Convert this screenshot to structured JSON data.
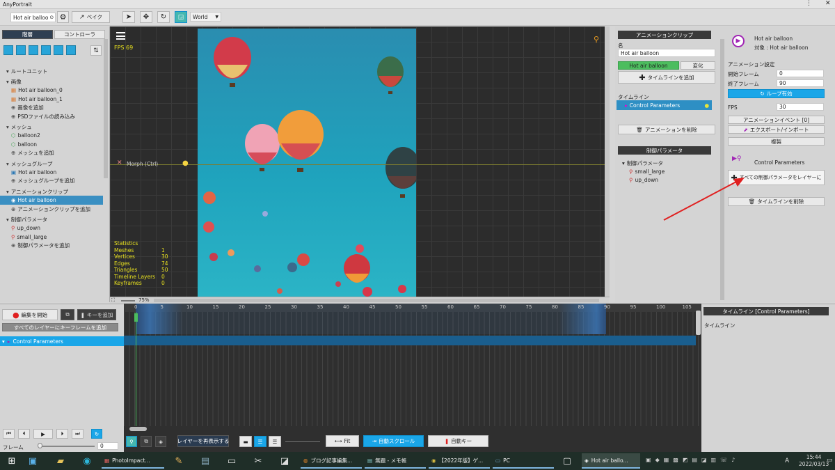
{
  "window": {
    "title": "AnyPortrait"
  },
  "toolbar": {
    "tab_name": "Hot air balloo",
    "bake_label": "ベイク",
    "coord_mode": "World"
  },
  "left_panel": {
    "tab_hierarchy": "階層",
    "tab_controller": "コントローラ",
    "tree": [
      {
        "label": "ルートユニット",
        "type": "section"
      },
      {
        "label": "画像",
        "type": "section"
      },
      {
        "label": "Hot air balloon_0",
        "type": "image"
      },
      {
        "label": "Hot air balloon_1",
        "type": "image"
      },
      {
        "label": "画像を追加",
        "type": "add"
      },
      {
        "label": "PSDファイルの読み込み",
        "type": "add"
      },
      {
        "label": "メッシュ",
        "type": "section"
      },
      {
        "label": "balloon2",
        "type": "mesh"
      },
      {
        "label": "balloon",
        "type": "mesh"
      },
      {
        "label": "メッシュを追加",
        "type": "add"
      },
      {
        "label": "メッシュグループ",
        "type": "section"
      },
      {
        "label": "Hot air balloon",
        "type": "meshgroup"
      },
      {
        "label": "メッシュグループを追加",
        "type": "add"
      },
      {
        "label": "アニメーションクリップ",
        "type": "section"
      },
      {
        "label": "Hot air balloon",
        "type": "anim",
        "selected": true
      },
      {
        "label": "アニメーションクリップを追加",
        "type": "add"
      },
      {
        "label": "制御パラメータ",
        "type": "section"
      },
      {
        "label": "up_down",
        "type": "param"
      },
      {
        "label": "small_large",
        "type": "param"
      },
      {
        "label": "制御パラメータを追加",
        "type": "add"
      }
    ]
  },
  "viewport": {
    "fps": "FPS 69",
    "morph_label": "Morph (Ctrl)",
    "zoom": "75%",
    "stats_title": "Statistics",
    "stats": [
      {
        "k": "Meshes",
        "v": "1"
      },
      {
        "k": "Vertices",
        "v": "30"
      },
      {
        "k": "Edges",
        "v": "74"
      },
      {
        "k": "Triangles",
        "v": "50"
      },
      {
        "k": "Timeline Layers",
        "v": "0"
      },
      {
        "k": "Keyframes",
        "v": "0"
      }
    ]
  },
  "anim_panel": {
    "header": "アニメーションクリップ",
    "name_label": "名",
    "name_value": "Hot air balloon",
    "tab_active": "Hot air balloon",
    "tab_change": "変化",
    "add_timeline": "タイムラインを追加",
    "timeline_label": "タイムライン",
    "timeline_item": "Control Parameters",
    "delete_anim": "アニメーションを削除",
    "param_header": "制御パラメータ",
    "param_group": "制御パラメータ",
    "params": [
      "small_large",
      "up_down"
    ]
  },
  "props_panel": {
    "title": "Hot air balloon",
    "target": "対象 : Hot air balloon",
    "settings_label": "アニメーション設定",
    "start_label": "開始フレーム",
    "start_value": "0",
    "end_label": "終了フレーム",
    "end_value": "90",
    "loop_button": "ループ有効",
    "fps_label": "FPS",
    "fps_value": "30",
    "events_button": "アニメーションイベント [0]",
    "export_button": "エクスポート/インポート",
    "duplicate_button": "複製",
    "timeline_name": "Control Parameters",
    "add_all_params_button": "すべての制御パラメータをレイヤーに",
    "delete_timeline_button": "タイムラインを削除"
  },
  "timeline": {
    "start_edit": "編集を開始",
    "add_key": "キーを追加",
    "add_keyframes_all": "すべてのレイヤーにキーフレームを追加",
    "layer": "Control Parameters",
    "ticks": [
      "0",
      "5",
      "10",
      "15",
      "20",
      "25",
      "30",
      "35",
      "40",
      "45",
      "50",
      "55",
      "60",
      "65",
      "70",
      "75",
      "80",
      "85",
      "90",
      "95",
      "100",
      "105"
    ],
    "frame_label": "フレーム",
    "frame_value": "0",
    "redisplay_layers": "レイヤーを再表示する",
    "fit": "Fit",
    "auto_scroll": "自動スクロール",
    "auto_key": "自動キー",
    "right_header": "タイムライン [Control Parameters]",
    "right_label": "タイムライン"
  },
  "taskbar": {
    "apps": [
      {
        "label": "PhotoImpact...",
        "icon": "photoimpact-icon"
      },
      {
        "label": "ブログ記事編集...",
        "icon": "firefox-icon"
      },
      {
        "label": "無題 - メモ帳",
        "icon": "notepad-icon"
      },
      {
        "label": "【2022年版】ゲ...",
        "icon": "chrome-icon"
      },
      {
        "label": "PC",
        "icon": "pc-icon"
      },
      {
        "label": "Hot air ballo...",
        "icon": "unity-icon"
      }
    ],
    "time": "15:44",
    "date": "2022/03/13",
    "ime": "A"
  },
  "colors": {
    "accent": "#1aa6e8",
    "green": "#4cbd5e",
    "sky": "#1f97b0"
  }
}
